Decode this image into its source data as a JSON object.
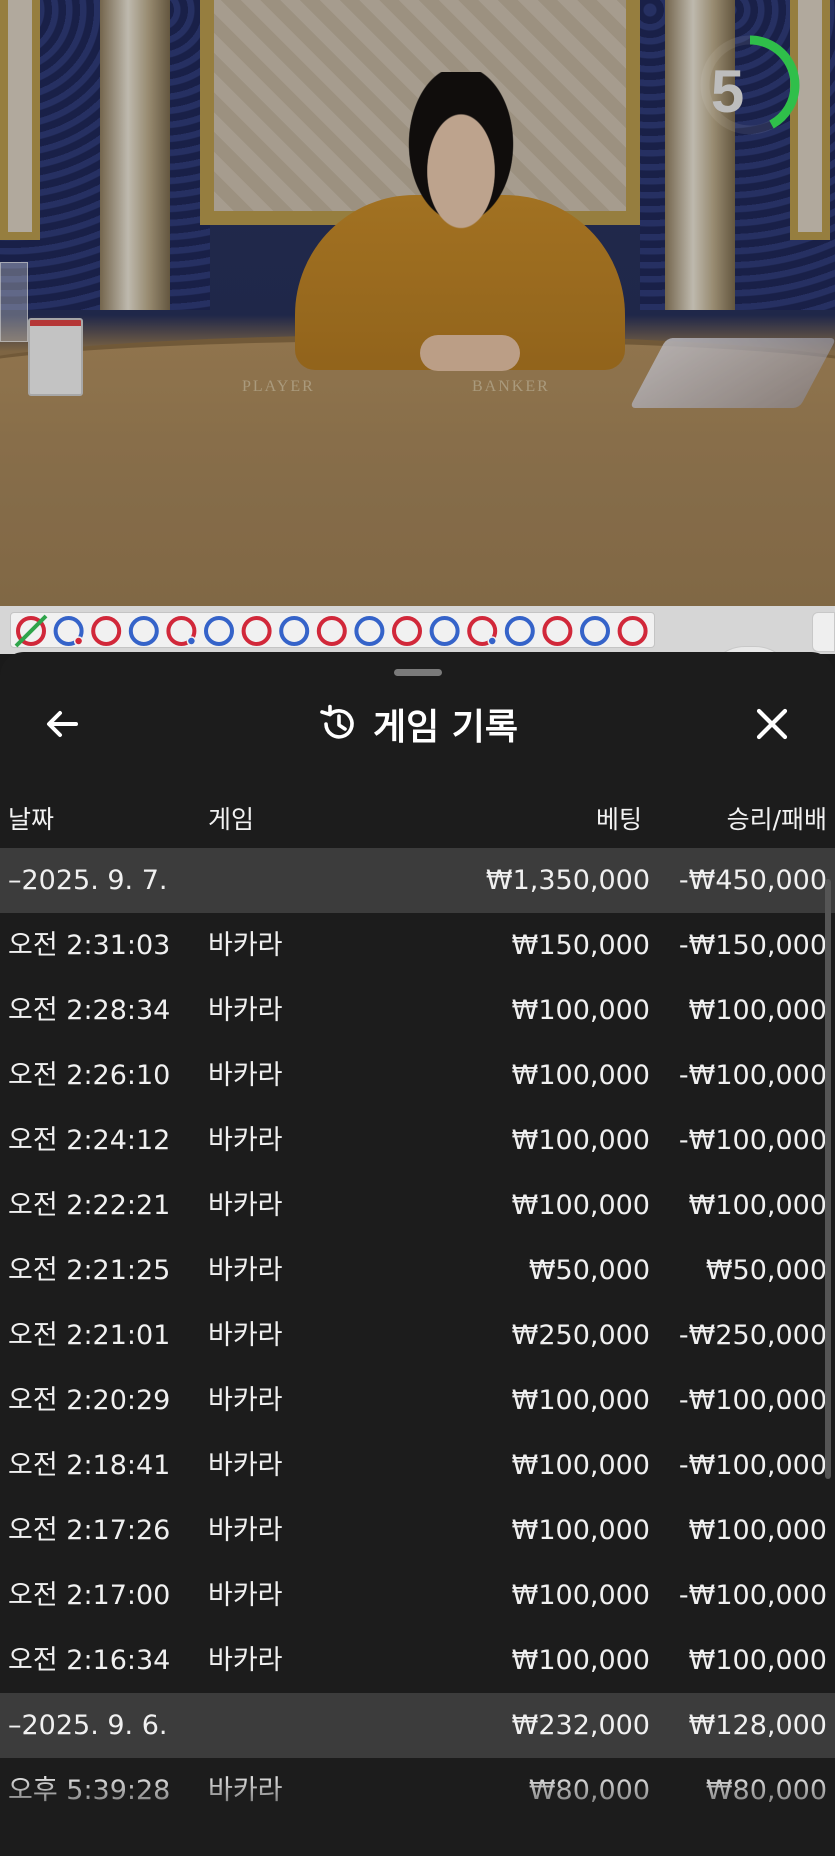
{
  "video": {
    "timer": {
      "value": "5",
      "fraction_remaining": 0.42,
      "color": "#2fbf4a"
    },
    "felt_labels": {
      "player": "PLAYER",
      "banker": "BANKER"
    }
  },
  "bead_road": {
    "colors": {
      "banker": "#d1283a",
      "player": "#3563c9",
      "tie": "#2fa44a"
    },
    "beads": [
      {
        "result": "banker",
        "tie": true
      },
      {
        "result": "player",
        "dot": true
      },
      {
        "result": "banker"
      },
      {
        "result": "player"
      },
      {
        "result": "banker",
        "dot": true
      },
      {
        "result": "player"
      },
      {
        "result": "banker"
      },
      {
        "result": "player"
      },
      {
        "result": "banker"
      },
      {
        "result": "player"
      },
      {
        "result": "banker"
      },
      {
        "result": "player"
      },
      {
        "result": "banker",
        "dot": true
      },
      {
        "result": "player"
      },
      {
        "result": "banker"
      },
      {
        "result": "player"
      },
      {
        "result": "banker"
      }
    ]
  },
  "sheet": {
    "title": "게임 기록",
    "icons": {
      "back": "arrow-left-icon",
      "history": "history-icon",
      "close": "close-icon"
    },
    "columns": {
      "date": "날짜",
      "game": "게임",
      "bet": "베팅",
      "result": "승리/패배"
    },
    "rows": [
      {
        "type": "group",
        "date": "–2025. 9. 7.",
        "game": "",
        "bet": "₩1,350,000",
        "result": "-₩450,000"
      },
      {
        "type": "item",
        "date": "오전 2:31:03",
        "game": "바카라",
        "bet": "₩150,000",
        "result": "-₩150,000"
      },
      {
        "type": "item",
        "date": "오전 2:28:34",
        "game": "바카라",
        "bet": "₩100,000",
        "result": "₩100,000"
      },
      {
        "type": "item",
        "date": "오전 2:26:10",
        "game": "바카라",
        "bet": "₩100,000",
        "result": "-₩100,000"
      },
      {
        "type": "item",
        "date": "오전 2:24:12",
        "game": "바카라",
        "bet": "₩100,000",
        "result": "-₩100,000"
      },
      {
        "type": "item",
        "date": "오전 2:22:21",
        "game": "바카라",
        "bet": "₩100,000",
        "result": "₩100,000"
      },
      {
        "type": "item",
        "date": "오전 2:21:25",
        "game": "바카라",
        "bet": "₩50,000",
        "result": "₩50,000"
      },
      {
        "type": "item",
        "date": "오전 2:21:01",
        "game": "바카라",
        "bet": "₩250,000",
        "result": "-₩250,000"
      },
      {
        "type": "item",
        "date": "오전 2:20:29",
        "game": "바카라",
        "bet": "₩100,000",
        "result": "-₩100,000"
      },
      {
        "type": "item",
        "date": "오전 2:18:41",
        "game": "바카라",
        "bet": "₩100,000",
        "result": "-₩100,000"
      },
      {
        "type": "item",
        "date": "오전 2:17:26",
        "game": "바카라",
        "bet": "₩100,000",
        "result": "₩100,000"
      },
      {
        "type": "item",
        "date": "오전 2:17:00",
        "game": "바카라",
        "bet": "₩100,000",
        "result": "-₩100,000"
      },
      {
        "type": "item",
        "date": "오전 2:16:34",
        "game": "바카라",
        "bet": "₩100,000",
        "result": "₩100,000"
      },
      {
        "type": "group",
        "date": "–2025. 9. 6.",
        "game": "",
        "bet": "₩232,000",
        "result": "₩128,000"
      },
      {
        "type": "item",
        "date": "오후 5:39:28",
        "game": "바카라",
        "bet": "₩80,000",
        "result": "₩80,000"
      }
    ]
  }
}
